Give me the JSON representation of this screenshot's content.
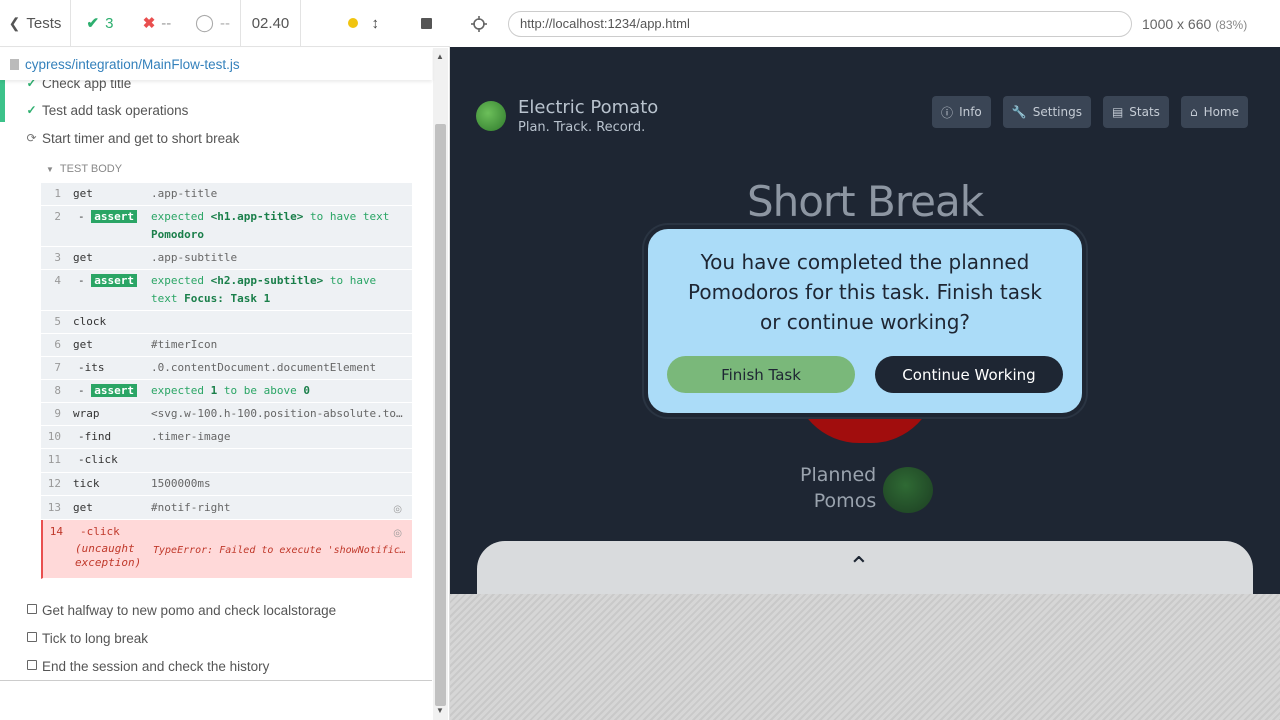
{
  "header": {
    "tests_label": "Tests",
    "passed": "3",
    "failed": "--",
    "pending": "--",
    "duration": "02.40"
  },
  "spec": {
    "path": "cypress/integration/MainFlow-test.js"
  },
  "tests": [
    {
      "title": "Check app title",
      "state": "passed"
    },
    {
      "title": "Test add task operations",
      "state": "passed"
    },
    {
      "title": "Start timer and get to short break",
      "state": "running"
    },
    {
      "title": "Get halfway to new pomo and check localstorage",
      "state": "pending"
    },
    {
      "title": "Tick to long break",
      "state": "pending"
    },
    {
      "title": "End the session and check the history",
      "state": "pending"
    }
  ],
  "test_body_label": "TEST BODY",
  "commands": [
    {
      "num": "1",
      "name": "get",
      "msg": ".app-title"
    },
    {
      "num": "2",
      "name": "-",
      "badge": "assert",
      "pre": "expected ",
      "sel": "<h1.app-title>",
      "mid": " to have text ",
      "val": "Pomodoro"
    },
    {
      "num": "3",
      "name": "get",
      "msg": ".app-subtitle"
    },
    {
      "num": "4",
      "name": "-",
      "badge": "assert",
      "pre": "expected ",
      "sel": "<h2.app-subtitle>",
      "mid": " to have text ",
      "val": "Focus: Task 1"
    },
    {
      "num": "5",
      "name": "clock",
      "msg": ""
    },
    {
      "num": "6",
      "name": "get",
      "msg": "#timerIcon"
    },
    {
      "num": "7",
      "name": "-its",
      "msg": ".0.contentDocument.documentElement"
    },
    {
      "num": "8",
      "name": "-",
      "badge": "assert",
      "pre": "expected ",
      "sel": "1",
      "mid": " to be above ",
      "val": "0"
    },
    {
      "num": "9",
      "name": "wrap",
      "msg": "<svg.w-100.h-100.position-absolute.to..."
    },
    {
      "num": "10",
      "name": "-find",
      "msg": ".timer-image"
    },
    {
      "num": "11",
      "name": "-click",
      "msg": ""
    },
    {
      "num": "12",
      "name": "tick",
      "msg": "1500000ms"
    },
    {
      "num": "13",
      "name": "get",
      "msg": "#notif-right"
    },
    {
      "num": "14",
      "name": "-click",
      "msg": ""
    },
    {
      "num": "",
      "name": "(uncaught exception)",
      "msg": "TypeError: Failed to execute 'showNotificat..."
    }
  ],
  "aut": {
    "url": "http://localhost:1234/app.html",
    "viewport": "1000 x 660",
    "scale": "(83%)"
  },
  "app": {
    "brand_title": "Electric Pomato",
    "brand_subtitle": "Plan. Track. Record.",
    "nav": [
      "Info",
      "Settings",
      "Stats",
      "Home"
    ],
    "page_title": "Short Break",
    "modal_text": "You have completed the planned Pomodoros for this task. Finish task or continue working?",
    "finish_label": "Finish Task",
    "continue_label": "Continue Working",
    "planned_line1": "Planned",
    "planned_line2": "Pomos"
  },
  "colors": {
    "passed": "#2eaf6f",
    "failed": "#e94f4f",
    "app_bg": "#1e2633",
    "modal_bg": "#abdcf8",
    "finish_btn": "#7ab87a"
  }
}
